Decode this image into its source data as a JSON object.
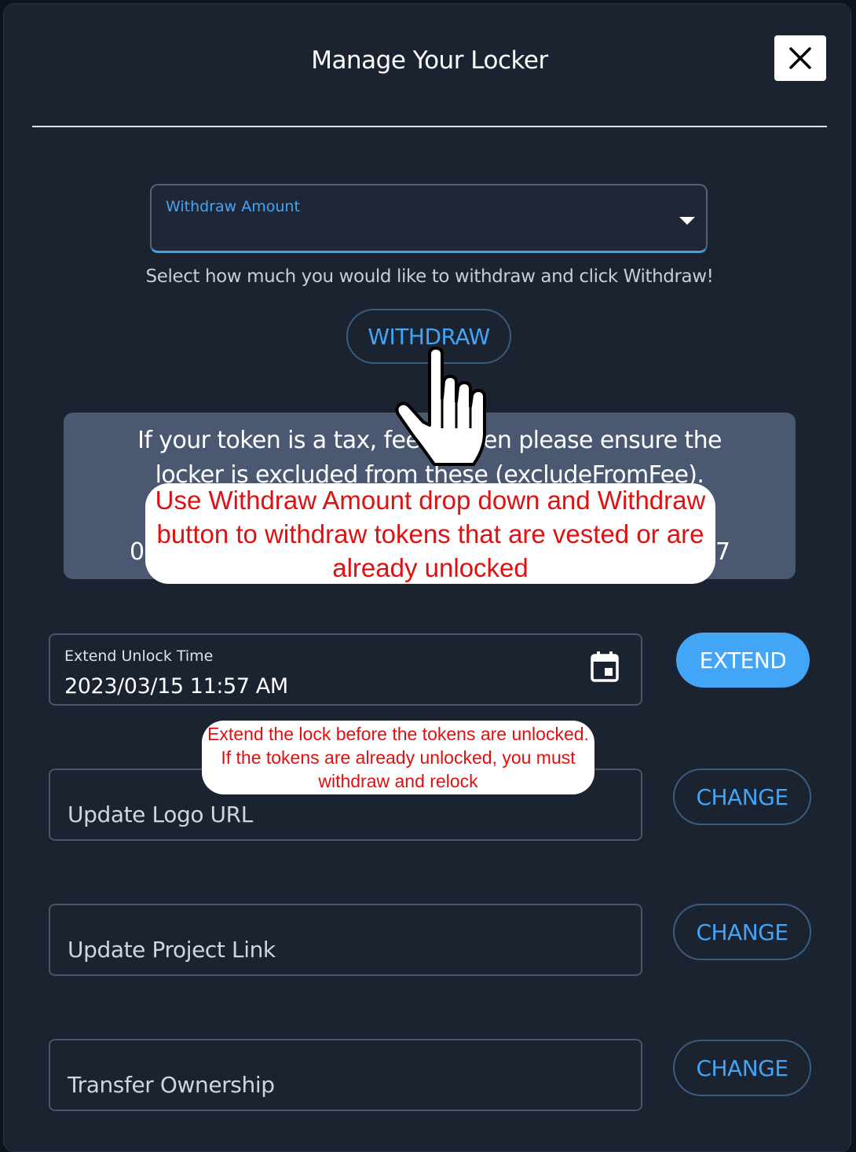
{
  "modal": {
    "title": "Manage Your Locker"
  },
  "withdraw": {
    "select_label": "Withdraw Amount",
    "helper_text": "Select how much you would like to withdraw and click Withdraw!",
    "button_label": "WITHDRAW"
  },
  "info_box": {
    "line1": "If your token is a tax, fee or      oken please ensure the",
    "line2": "locker is excluded from these (excludeFromFee).",
    "fragment_left": "0",
    "fragment_right": "7"
  },
  "annotations": {
    "withdraw_note": "Use Withdraw Amount drop down and Withdraw button to withdraw tokens that are vested or are already unlocked",
    "extend_note": "Extend the lock before the tokens are unlocked. If the tokens are already unlocked, you must withdraw and relock"
  },
  "extend": {
    "label": "Extend Unlock Time",
    "value": "2023/03/15 11:57 AM",
    "button_label": "EXTEND"
  },
  "fields": [
    {
      "placeholder": "Update Logo URL",
      "button_label": "CHANGE"
    },
    {
      "placeholder": "Update Project Link",
      "button_label": "CHANGE"
    },
    {
      "placeholder": "Transfer Ownership",
      "button_label": "CHANGE"
    }
  ],
  "icons": {
    "close": "close-icon",
    "calendar": "calendar-icon",
    "dropdown": "caret-down-icon",
    "cursor": "hand-pointer-icon"
  },
  "colors": {
    "accent": "#42a5f5",
    "background": "#1b2230",
    "annotation_text": "#e01010"
  }
}
